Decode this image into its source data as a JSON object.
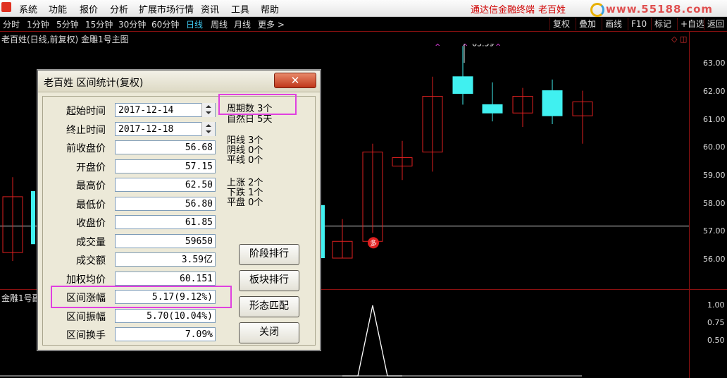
{
  "menu": {
    "items": [
      "系统",
      "功能",
      "报价",
      "分析",
      "扩展市场行情",
      "资讯",
      "工具",
      "帮助"
    ],
    "brand": "通达信金融终端",
    "brand_name": "老百姓",
    "logo_text": "www.55188.com"
  },
  "periods": [
    "分时",
    "1分钟",
    "5分钟",
    "15分钟",
    "30分钟",
    "60分钟",
    "日线",
    "周线",
    "月线",
    "更多 >"
  ],
  "active_period": "日线",
  "tools": [
    "复权",
    "叠加",
    "画线",
    "F10",
    "标记",
    "+自选",
    "返回"
  ],
  "chart": {
    "title": "老百姓(日线,前复权) 金雕1号主图",
    "sub_title": "金雕1号副",
    "peak_label": "63.59",
    "signal_label": "多",
    "y_labels": [
      "63.00",
      "62.00",
      "61.00",
      "60.00",
      "59.00",
      "58.00",
      "57.00",
      "56.00"
    ],
    "sub_y_labels": [
      "1.00",
      "0.75",
      "0.50"
    ],
    "accent_color": "#e02020",
    "up_color": "#e02020",
    "down_color": "#40f0f0"
  },
  "chart_data": {
    "type": "candlestick",
    "ylim": [
      55.3,
      63.7
    ],
    "candles": [
      {
        "open": 58.2,
        "close": 56.2,
        "high": 58.9,
        "low": 55.9,
        "dir": "up"
      },
      {
        "open": 56.0,
        "close": 56.6,
        "high": 57.4,
        "low": 56.0,
        "dir": "up"
      },
      {
        "open": 56.6,
        "close": 59.8,
        "high": 60.1,
        "low": 56.9,
        "dir": "up"
      },
      {
        "open": 59.3,
        "close": 59.6,
        "high": 60.2,
        "low": 58.8,
        "dir": "up"
      },
      {
        "open": 59.8,
        "close": 61.8,
        "high": 62.5,
        "low": 59.1,
        "dir": "up"
      },
      {
        "open": 62.5,
        "close": 61.9,
        "high": 63.6,
        "low": 61.5,
        "dir": "down"
      },
      {
        "open": 61.5,
        "close": 61.2,
        "high": 62.3,
        "low": 60.9,
        "dir": "down"
      },
      {
        "open": 61.2,
        "close": 61.8,
        "high": 62.1,
        "low": 60.7,
        "dir": "up"
      },
      {
        "open": 62.0,
        "close": 61.1,
        "high": 62.4,
        "low": 60.8,
        "dir": "down"
      },
      {
        "open": 61.1,
        "close": 61.6,
        "high": 62.0,
        "low": 60.1,
        "dir": "up"
      }
    ],
    "reference_line": 57.15,
    "sub_series": [
      0,
      0,
      1.0,
      0,
      0
    ]
  },
  "dialog": {
    "title": "老百姓 区间统计(复权)",
    "close_label": "✕",
    "fields": [
      {
        "label": "起始时间",
        "value": "2017-12-14"
      },
      {
        "label": "终止时间",
        "value": "2017-12-18"
      },
      {
        "label": "前收盘价",
        "value": "56.68"
      },
      {
        "label": "开盘价",
        "value": "57.15"
      },
      {
        "label": "最高价",
        "value": "62.50"
      },
      {
        "label": "最低价",
        "value": "56.80"
      },
      {
        "label": "收盘价",
        "value": "61.85"
      },
      {
        "label": "成交量",
        "value": "59650"
      },
      {
        "label": "成交额",
        "value": "3.59亿"
      },
      {
        "label": "加权均价",
        "value": "60.151"
      },
      {
        "label": "区间涨幅",
        "value": "5.17(9.12%)"
      },
      {
        "label": "区间振幅",
        "value": "5.70(10.04%)"
      },
      {
        "label": "区间换手",
        "value": "7.09%"
      }
    ],
    "stats": {
      "period_count": "周期数  3个",
      "natural_days": "自然日  5天",
      "yang": "阳线  3个",
      "yin": "阴线  0个",
      "flat_line": "平线  0个",
      "up": "上涨  2个",
      "down": "下跌  1个",
      "flat": "平盘  0个"
    },
    "buttons": [
      "阶段排行",
      "板块排行",
      "形态匹配",
      "关闭"
    ],
    "highlight_color": "#e040e0"
  }
}
